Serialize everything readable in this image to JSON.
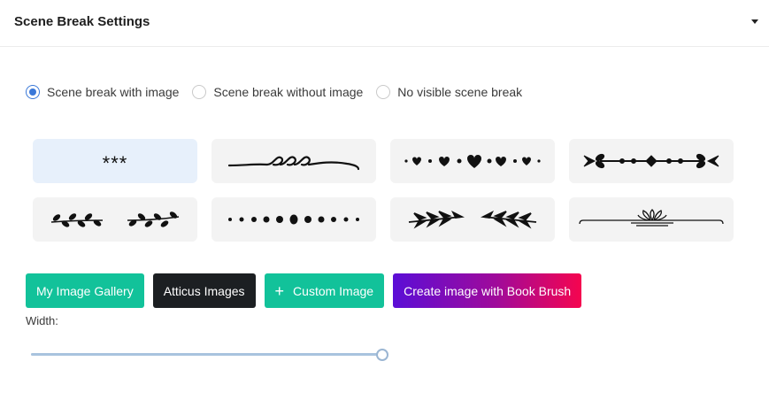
{
  "header": {
    "title": "Scene Break Settings",
    "collapse_icon": "caret-down-icon"
  },
  "scene_break_options": [
    {
      "label": "Scene break with image",
      "selected": true
    },
    {
      "label": "Scene break without image",
      "selected": false
    },
    {
      "label": "No visible scene break",
      "selected": false
    }
  ],
  "ornaments": {
    "selected_index": 0,
    "items": [
      {
        "name": "asterisks",
        "text": "***"
      },
      {
        "name": "swirl-flourish-icon"
      },
      {
        "name": "hearts-dots-icon"
      },
      {
        "name": "arrow-vine-icon"
      },
      {
        "name": "laurel-branches-icon"
      },
      {
        "name": "dots-row-icon"
      },
      {
        "name": "leaf-arrows-icon"
      },
      {
        "name": "floral-bracket-icon"
      }
    ]
  },
  "buttons": {
    "gallery": "My Image Gallery",
    "atticus": "Atticus Images",
    "custom_icon": "plus-icon",
    "custom": "Custom Image",
    "bookbrush": "Create image with Book Brush"
  },
  "colors": {
    "accent_green": "#12c29a",
    "dark_button": "#1c1f22",
    "radio_blue": "#3a78d8",
    "gradient_start": "#5b0ed6",
    "gradient_end": "#f5054f"
  },
  "width": {
    "label": "Width:",
    "value_percent": 100
  }
}
